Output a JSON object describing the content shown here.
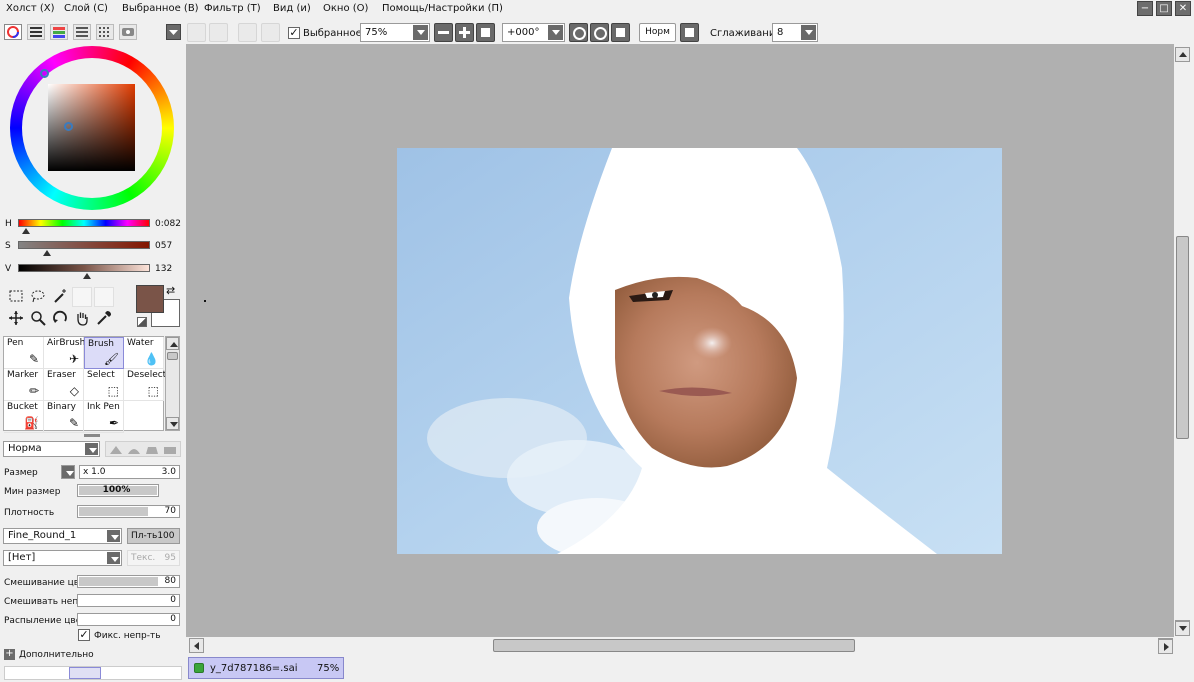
{
  "menu": {
    "items": [
      "Холст (X)",
      "Слой (С)",
      "Выбранное (В)",
      "Фильтр (Т)",
      "Вид (и)",
      "Окно (О)",
      "Помощь/Настройки (П)"
    ]
  },
  "window_controls": {
    "minimize": "−",
    "restore": "□",
    "close": "✕"
  },
  "toolbar": {
    "selection_label": "Выбранное",
    "selection_checked": true,
    "zoom_value": "75%",
    "rotation_value": "+000°",
    "blend_mode": "Норм",
    "smoothing_label": "Сглаживание",
    "smoothing_value": "8"
  },
  "color": {
    "current": "#7a5448",
    "background": "#ffffff",
    "hue_label": "H",
    "hue_value": "0:082",
    "hue_fraction": 0.06,
    "sat_label": "S",
    "sat_value": "057",
    "sat_fraction": 0.22,
    "val_label": "V",
    "val_value": "132",
    "val_fraction": 0.52
  },
  "brushes": [
    {
      "label": "Pen",
      "icon": "pen-icon",
      "glyph": "✎"
    },
    {
      "label": "AirBrush",
      "icon": "airbrush-icon",
      "glyph": "✈"
    },
    {
      "label": "Brush",
      "icon": "brush-icon",
      "glyph": "🖌",
      "active": true
    },
    {
      "label": "Water",
      "icon": "water-icon",
      "glyph": "💧"
    },
    {
      "label": "Marker",
      "icon": "marker-icon",
      "glyph": "✏"
    },
    {
      "label": "Eraser",
      "icon": "eraser-icon",
      "glyph": "◇"
    },
    {
      "label": "Select",
      "icon": "select-icon",
      "glyph": "⬚"
    },
    {
      "label": "Deselect",
      "icon": "deselect-icon",
      "glyph": "⬚"
    },
    {
      "label": "Bucket",
      "icon": "bucket-icon",
      "glyph": "⛽"
    },
    {
      "label": "Binary",
      "icon": "binary-icon",
      "glyph": "✎"
    },
    {
      "label": "Ink Pen",
      "icon": "ink-pen-icon",
      "glyph": "✒"
    }
  ],
  "brush_props": {
    "mode": "Норма",
    "size_label": "Размер",
    "size_multiplier": "x 1.0",
    "size_value": "3.0",
    "min_size_label": "Мин размер",
    "min_size_value": "100%",
    "min_size_fraction": 1.0,
    "density_label": "Плотность",
    "density_value": "70",
    "density_fraction": 0.7,
    "shape": "Fine_Round_1",
    "shape_strength_label": "Пл-ть",
    "shape_strength_value": "100",
    "texture": "[Нет]",
    "texture_label": "Текс.",
    "texture_value": "95",
    "blend_label": "Смешивание цве",
    "blend_value": "80",
    "blend_fraction": 0.8,
    "dilution_label": "Смешивать непр",
    "dilution_value": "0",
    "spread_label": "Распыление цвет",
    "spread_value": "0",
    "keep_opacity_label": "Фикс. непр-ть",
    "keep_opacity_checked": true,
    "advanced_label": "Дополнительно"
  },
  "document_tab": {
    "filename": "у_7d787186=.sai",
    "zoom": "75%"
  }
}
